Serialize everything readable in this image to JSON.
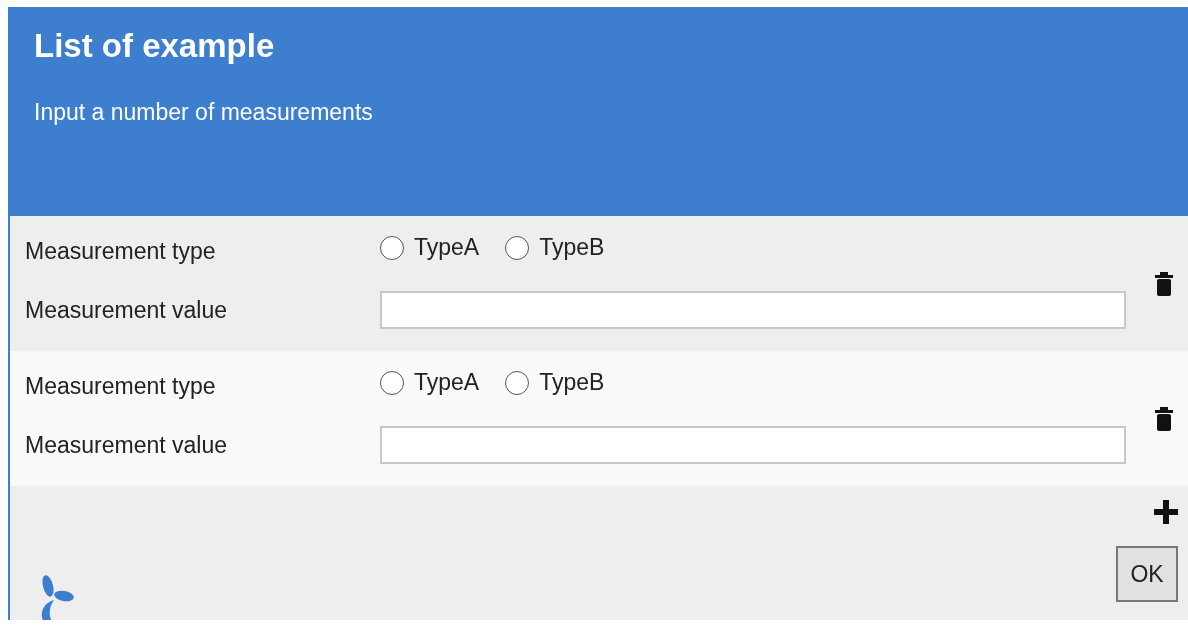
{
  "header": {
    "title": "List of example",
    "subtitle": "Input a number of measurements"
  },
  "measurements": [
    {
      "type_label": "Measurement type",
      "options": [
        {
          "label": "TypeA",
          "selected": false
        },
        {
          "label": "TypeB",
          "selected": false
        }
      ],
      "value_label": "Measurement value"
    },
    {
      "type_label": "Measurement type",
      "options": [
        {
          "label": "TypeA",
          "selected": false
        },
        {
          "label": "TypeB",
          "selected": false
        }
      ],
      "value_label": "Measurement value"
    }
  ],
  "ok_button": "OK"
}
